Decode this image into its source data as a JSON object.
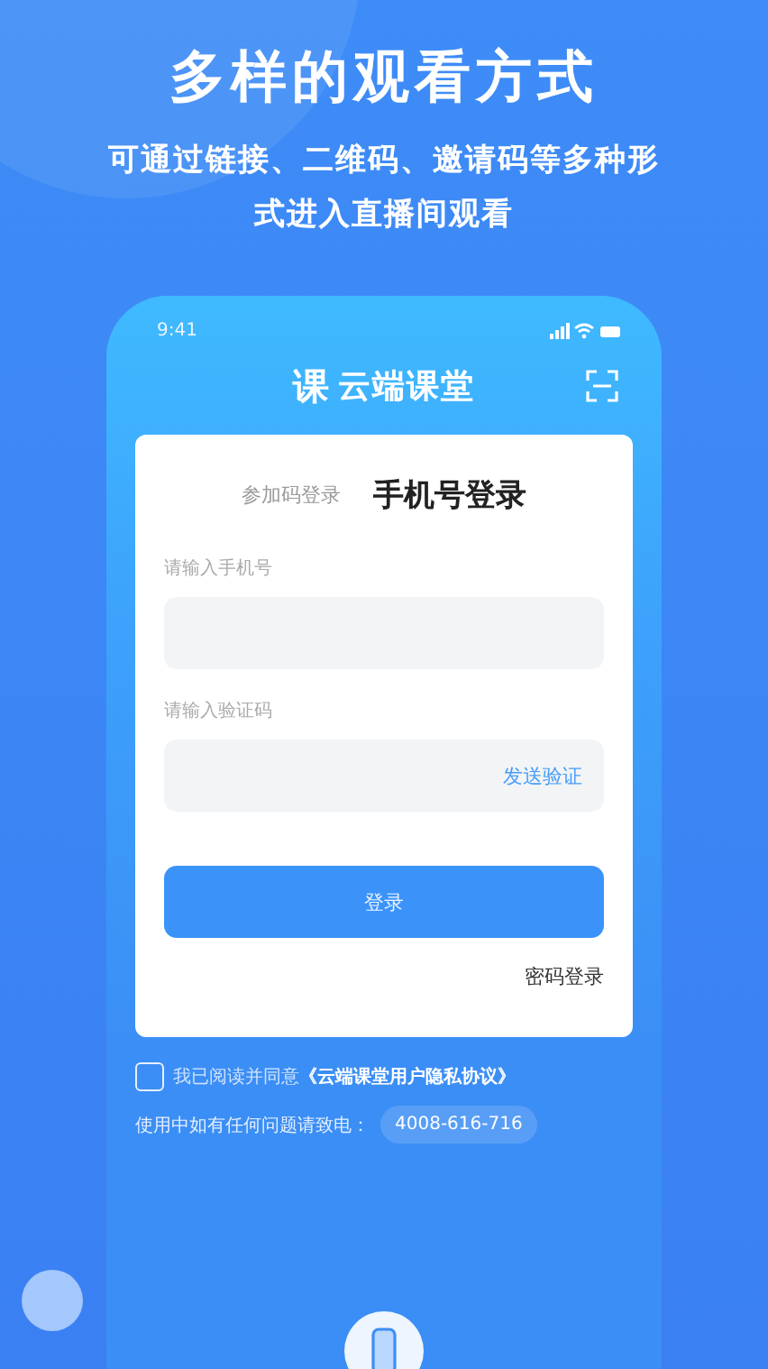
{
  "headline": "多样的观看方式",
  "subtitle": "可通过链接、二维码、邀请码等多种形式进入直播间观看",
  "status_bar": {
    "time": "9:41"
  },
  "app_header": {
    "logo_mark": "课",
    "app_name": "云端课堂"
  },
  "tabs": [
    {
      "label": "参加码登录",
      "selected": false
    },
    {
      "label": "手机号登录",
      "selected": true
    }
  ],
  "fields": [
    {
      "label": "请输入手机号"
    },
    {
      "label": "请输入验证码",
      "action": "发送验证"
    }
  ],
  "login_button": "登录",
  "password_login_link": "密码登录",
  "agreement": {
    "checked": false,
    "text": "我已阅读并同意**《云端课堂用户隐私协议》**"
  },
  "help": {
    "text": "使用中如有任何问题请致电：",
    "phone": "4008-616-716"
  }
}
